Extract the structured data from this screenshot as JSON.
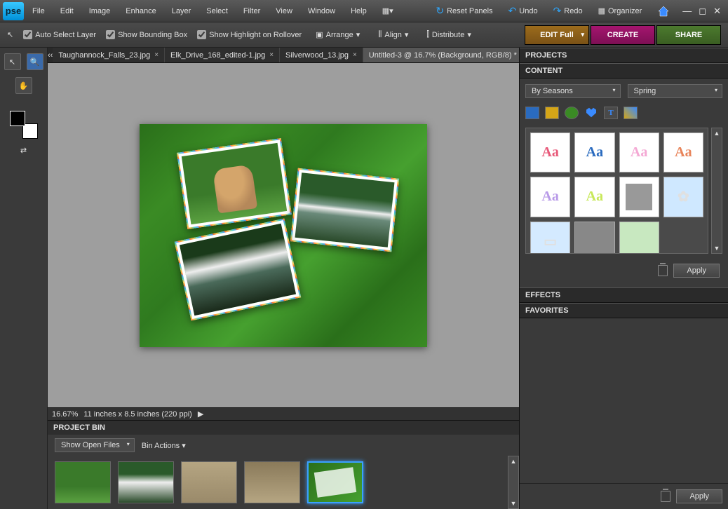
{
  "menu": {
    "items": [
      "File",
      "Edit",
      "Image",
      "Enhance",
      "Layer",
      "Select",
      "Filter",
      "View",
      "Window",
      "Help"
    ]
  },
  "topbar": {
    "reset": "Reset Panels",
    "undo": "Undo",
    "redo": "Redo",
    "organizer": "Organizer"
  },
  "options": {
    "auto_select": "Auto Select Layer",
    "bounding": "Show Bounding Box",
    "rollover": "Show Highlight on Rollover",
    "arrange": "Arrange",
    "align": "Align",
    "distribute": "Distribute"
  },
  "modes": {
    "edit": "EDIT Full",
    "create": "CREATE",
    "share": "SHARE"
  },
  "tabs": [
    {
      "label": "Taughannock_Falls_23.jpg",
      "active": false
    },
    {
      "label": "Elk_Drive_168_edited-1.jpg",
      "active": false
    },
    {
      "label": "Silverwood_13.jpg",
      "active": false
    },
    {
      "label": "Untitled-3 @ 16.7% (Background, RGB/8) *",
      "active": true
    }
  ],
  "status": {
    "zoom": "16.67%",
    "dims": "11 inches x 8.5 inches (220 ppi)"
  },
  "bin": {
    "title": "PROJECT BIN",
    "filter": "Show Open Files",
    "actions": "Bin Actions"
  },
  "panels": {
    "projects": "PROJECTS",
    "content": "CONTENT",
    "effects": "EFFECTS",
    "favorites": "FAVORITES",
    "filter1": "By Seasons",
    "filter2": "Spring",
    "apply": "Apply",
    "aa_colors": [
      "#e85a7a",
      "#2a6bbf",
      "#f4a8d4",
      "#e8845a",
      "#b89ae8",
      "#c8e85a"
    ]
  }
}
